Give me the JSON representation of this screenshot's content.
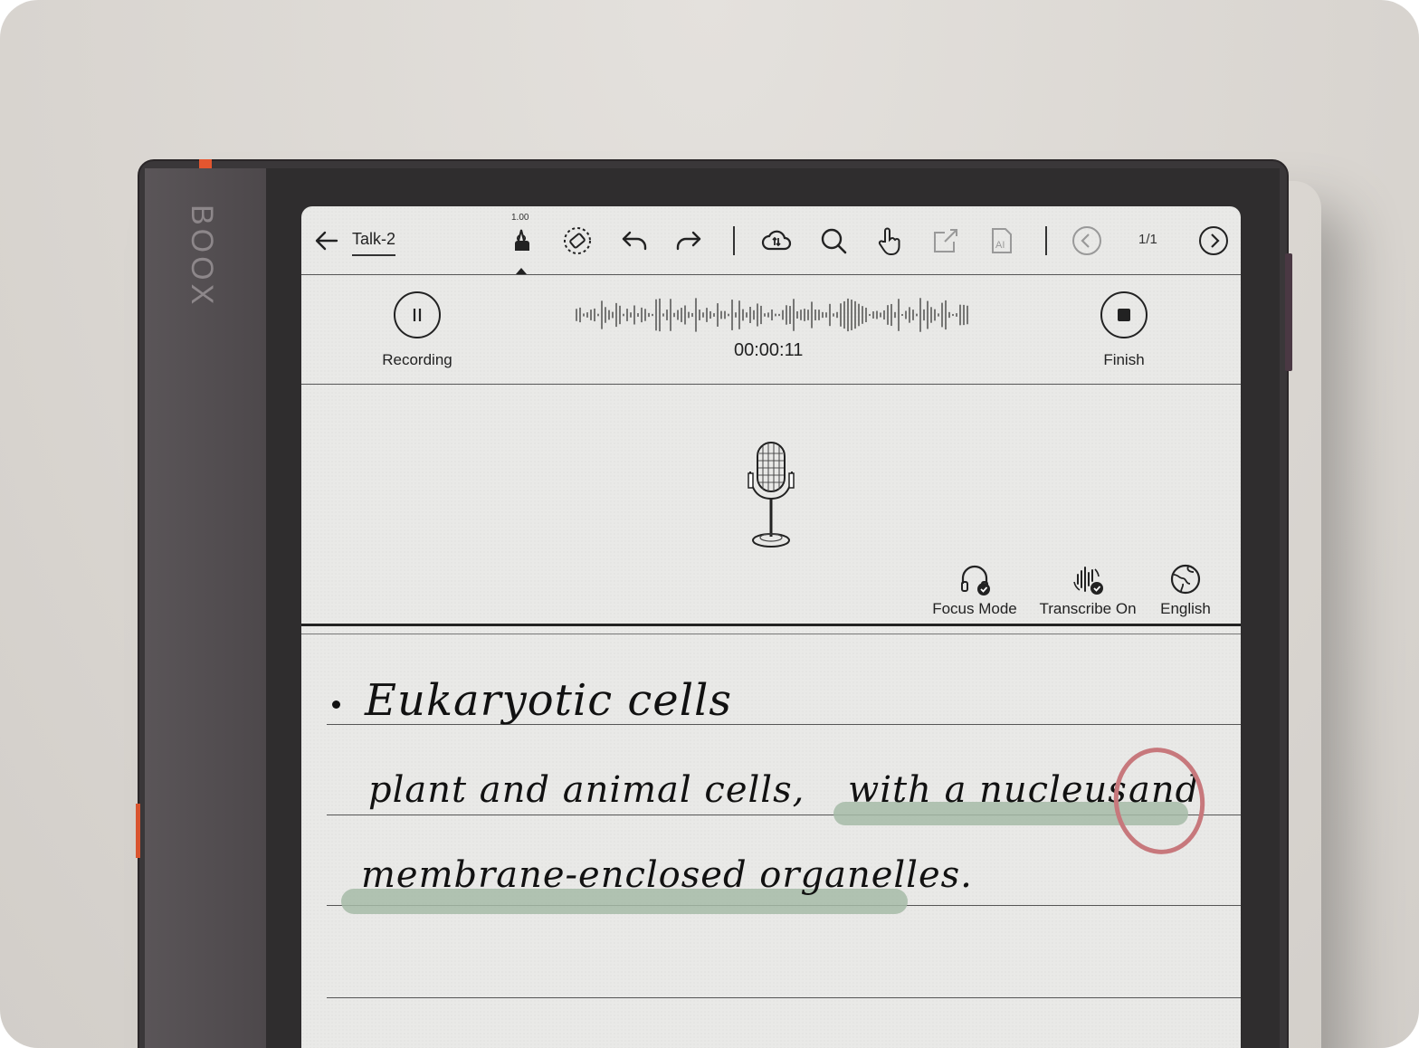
{
  "device": {
    "brand": "BOOX"
  },
  "toolbar": {
    "title": "Talk-2",
    "pen_size": "1.00",
    "page_indicator": "1/1",
    "icons": [
      "back-arrow-icon",
      "pen-icon",
      "eraser-icon",
      "undo-icon",
      "redo-icon",
      "cloud-sync-icon",
      "search-icon",
      "touch-icon",
      "export-icon",
      "ai-icon",
      "previous-page-icon",
      "next-page-icon"
    ]
  },
  "recorder": {
    "pause_label": "Recording",
    "timer": "00:00:11",
    "finish_label": "Finish"
  },
  "options": {
    "focus_mode": "Focus Mode",
    "transcribe": "Transcribe On",
    "language": "English"
  },
  "notes": {
    "line1": "Eukaryotic cells",
    "line2a": "plant and animal cells,",
    "line2b": "with a nucleus",
    "line2c": "and",
    "line3": "membrane-enclosed organelles."
  },
  "colors": {
    "highlight": "#a6bba7",
    "circle_mark": "#c7787c",
    "accent": "#e4562f"
  }
}
